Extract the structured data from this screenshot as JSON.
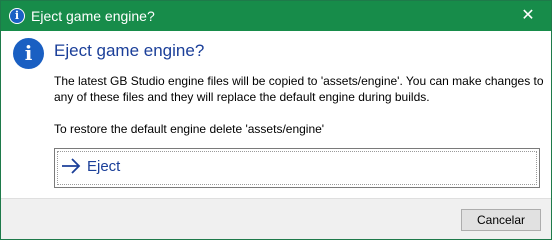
{
  "window": {
    "title": "Eject game engine?",
    "close_glyph": "✕"
  },
  "dialog": {
    "icon": "i",
    "heading": "Eject game engine?",
    "body": "The latest GB Studio engine files will be copied to 'assets/engine'. You can make changes to any of these files and they will replace the default engine during builds.",
    "note": "To restore the default engine delete 'assets/engine'",
    "command_link": {
      "label": "Eject",
      "icon": "arrow-right-icon"
    }
  },
  "footer": {
    "cancel_label": "Cancelar"
  },
  "colors": {
    "titlebar": "#178c4a",
    "heading": "#1b3f99",
    "info_icon": "#1a5fc2"
  }
}
